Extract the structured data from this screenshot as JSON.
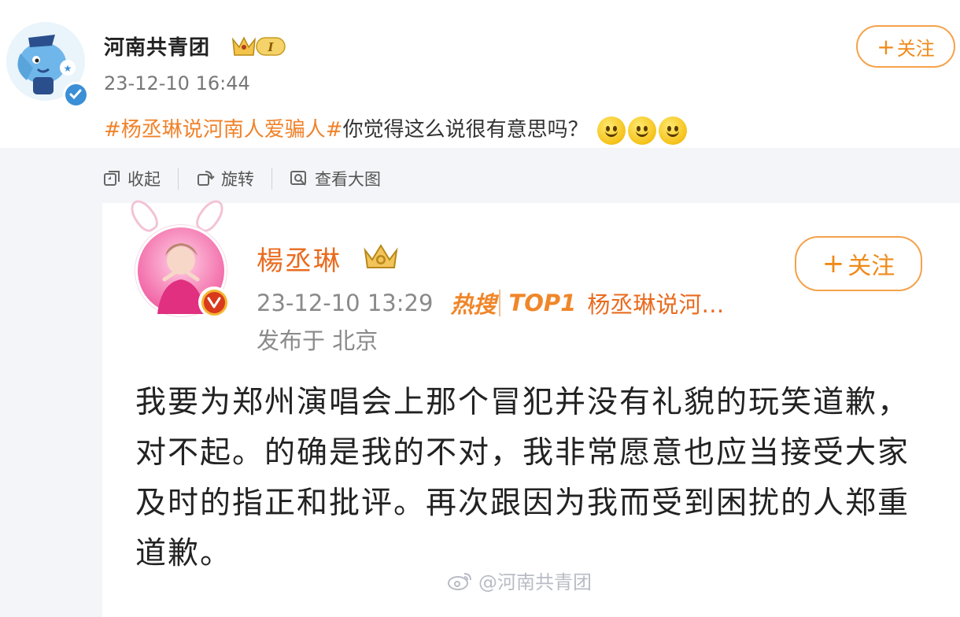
{
  "post": {
    "author": "河南共青团",
    "level_badge": "I",
    "timestamp": "23-12-10 16:44",
    "follow_label": "关注",
    "text_topic": "#杨丞琳说河南人爱骗人#",
    "text_body": "你觉得这么说很有意思吗？",
    "emoji_count": 3
  },
  "toolbar": {
    "collapse_label": "收起",
    "rotate_label": "旋转",
    "view_large_label": "查看大图"
  },
  "embedded": {
    "author": "楊丞琳",
    "timestamp": "23-12-10 13:29",
    "hot_label": "热搜",
    "rank_label": "TOP1",
    "hot_topic": "杨丞琳说河…",
    "location": "发布于 北京",
    "follow_label": "关注",
    "body": "我要为郑州演唱会上那个冒犯并没有礼貌的玩笑道歉，对不起。的确是我的不对，我非常愿意也应当接受大家及时的指正和批评。再次跟因为我而受到困扰的人郑重道歉。"
  },
  "watermark": "@河南共青团",
  "colors": {
    "accent_orange": "#f0822a",
    "verified_blue": "#3b8fd6",
    "verified_red": "#d93a1c",
    "panel_bg": "#f4f5f8"
  }
}
